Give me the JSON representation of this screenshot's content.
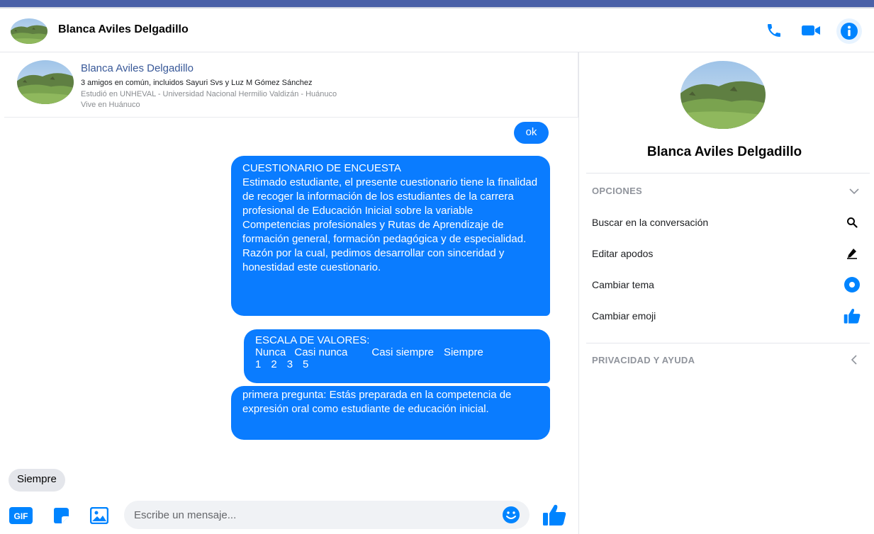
{
  "header": {
    "contact_name": "Blanca Aviles Delgadillo",
    "icons": [
      "phone-icon",
      "video-camera-icon",
      "info-icon"
    ],
    "accent_color": "#0084ff"
  },
  "profile_card": {
    "name": "Blanca Aviles Delgadillo",
    "mutual_friends": "3 amigos en común, incluidos Sayuri Svs y Luz M Gómez Sánchez",
    "education": "Estudió en UNHEVAL - Universidad Nacional Hermilio Valdizán - Huánuco",
    "lives": "Vive en Huánuco"
  },
  "messages": {
    "ok": "ok",
    "questionnaire_title": "CUESTIONARIO DE ENCUESTA",
    "questionnaire_body": "Estimado estudiante, el presente cuestionario tiene la finalidad de recoger la información de los estudiantes de la carrera profesional de Educación Inicial sobre la variable Competencias profesionales y Rutas de Aprendizaje de formación general, formación pedagógica y de especialidad. Razón por la cual, pedimos desarrollar con sinceridad y honestidad este cuestionario.",
    "scale_title": "ESCALA DE VALORES:",
    "scale_labels": [
      "Nunca",
      "Casi nunca",
      "Casi siempre",
      "Siempre"
    ],
    "scale_values": [
      "1",
      "2",
      "3",
      "5"
    ],
    "question_1": "primera pregunta: Estás preparada en la competencia de expresión oral como estudiante de educación inicial.",
    "reply": "Siempre",
    "bubble_color": "#0a7cff"
  },
  "composer": {
    "placeholder": "Escribe un mensaje...",
    "gif_label": "GIF",
    "icons": [
      "gif-icon",
      "sticker-icon",
      "photo-icon",
      "emoji-icon",
      "like-icon"
    ]
  },
  "sidebar": {
    "name": "Blanca Aviles Delgadillo",
    "options_heading": "OPCIONES",
    "options": [
      {
        "label": "Buscar en la conversación",
        "icon": "search-icon"
      },
      {
        "label": "Editar apodos",
        "icon": "pencil-icon"
      },
      {
        "label": "Cambiar tema",
        "icon": "theme-icon"
      },
      {
        "label": "Cambiar emoji",
        "icon": "like-icon"
      }
    ],
    "privacy_heading": "PRIVACIDAD Y AYUDA"
  }
}
